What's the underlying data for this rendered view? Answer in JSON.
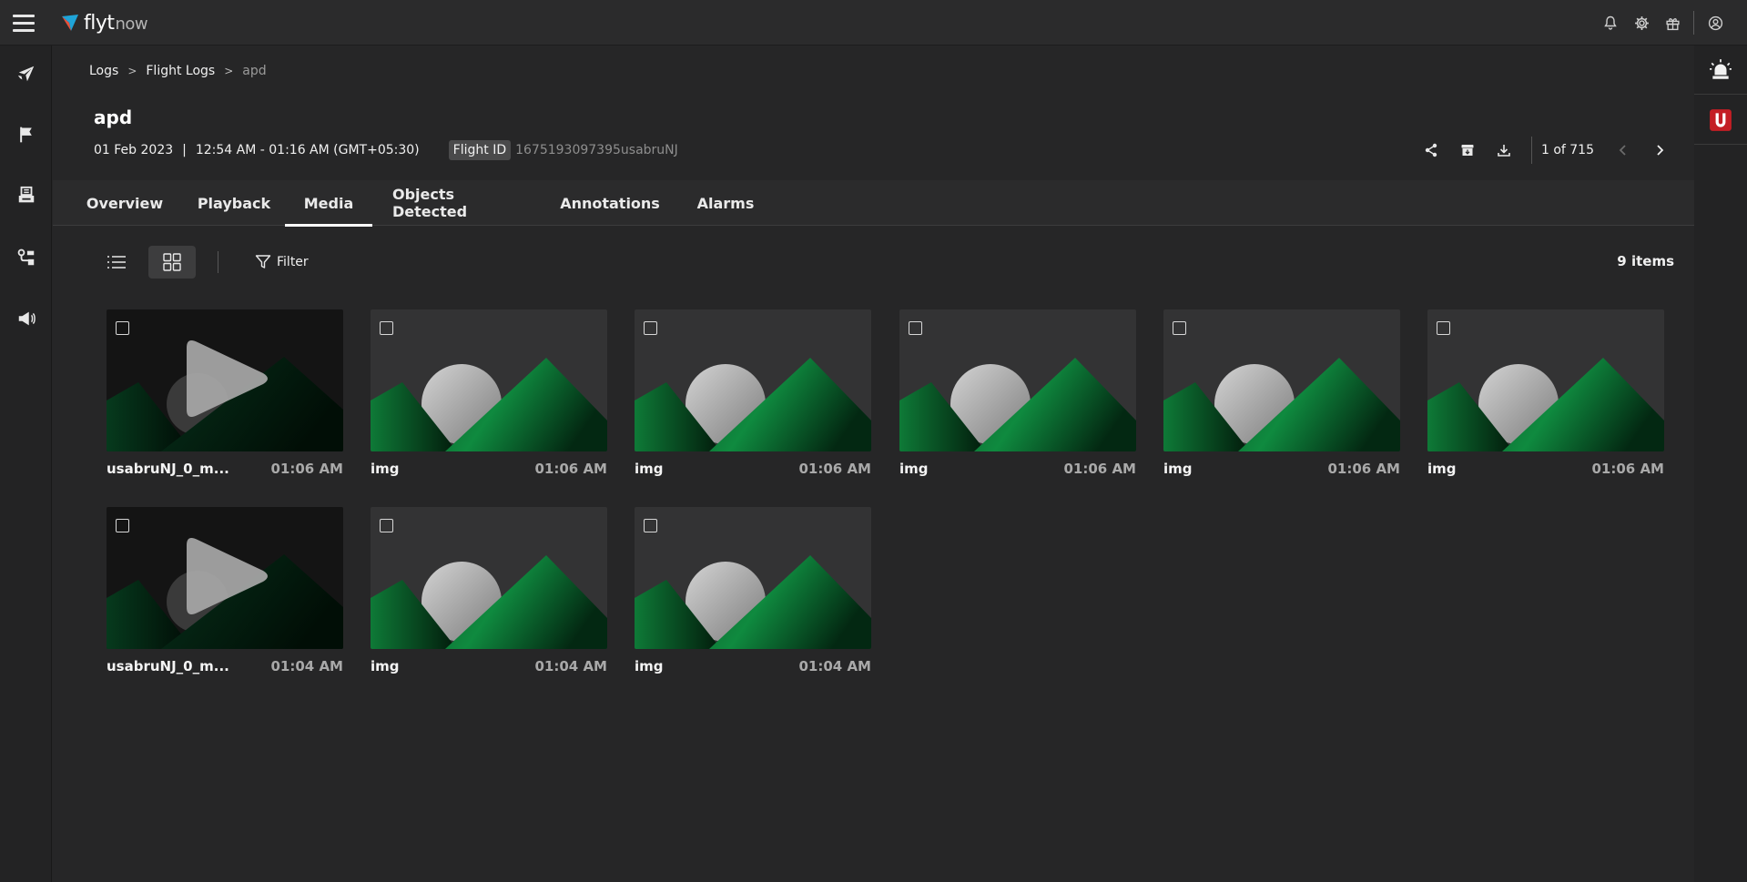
{
  "app": {
    "logo_text": "flyt",
    "logo_suffix": "now"
  },
  "topbar": {
    "icons": [
      "bell-icon",
      "gear-icon",
      "gift-icon",
      "user-circle-icon"
    ]
  },
  "sidebar": {
    "items": [
      "airplane-icon",
      "flag-icon",
      "printer-icon",
      "route-icon",
      "megaphone-icon"
    ]
  },
  "rightbar": {
    "items": [
      "alarm-siren-icon",
      "app-badge-icon"
    ],
    "accent": "#c41e24"
  },
  "breadcrumb": {
    "items": [
      "Logs",
      "Flight Logs",
      "apd"
    ],
    "separator": ">"
  },
  "flight": {
    "title": "apd",
    "date": "01 Feb 2023",
    "pipe": "|",
    "time_range": "12:54 AM - 01:16 AM (GMT+05:30)",
    "id_label": "Flight ID",
    "id_value": "1675193097395usabruNJ"
  },
  "toolbar": {
    "icons": [
      "share-icon",
      "archive-icon",
      "download-icon"
    ],
    "pager": "1 of 715"
  },
  "tabs": [
    {
      "label": "Overview",
      "active": false
    },
    {
      "label": "Playback",
      "active": false
    },
    {
      "label": "Media",
      "active": true
    },
    {
      "label": "Objects Detected",
      "active": false
    },
    {
      "label": "Annotations",
      "active": false
    },
    {
      "label": "Alarms",
      "active": false
    }
  ],
  "media_toolbar": {
    "view_modes": [
      "list",
      "grid"
    ],
    "active_view": "grid",
    "filter_label": "Filter",
    "count_label": "9 items"
  },
  "media": [
    {
      "type": "video",
      "name": "usabruNJ_0_m...",
      "time": "01:06 AM"
    },
    {
      "type": "image",
      "name": "img",
      "time": "01:06 AM"
    },
    {
      "type": "image",
      "name": "img",
      "time": "01:06 AM"
    },
    {
      "type": "image",
      "name": "img",
      "time": "01:06 AM"
    },
    {
      "type": "image",
      "name": "img",
      "time": "01:06 AM"
    },
    {
      "type": "image",
      "name": "img",
      "time": "01:06 AM"
    },
    {
      "type": "video",
      "name": "usabruNJ_0_m...",
      "time": "01:04 AM"
    },
    {
      "type": "image",
      "name": "img",
      "time": "01:04 AM"
    },
    {
      "type": "image",
      "name": "img",
      "time": "01:04 AM"
    }
  ]
}
